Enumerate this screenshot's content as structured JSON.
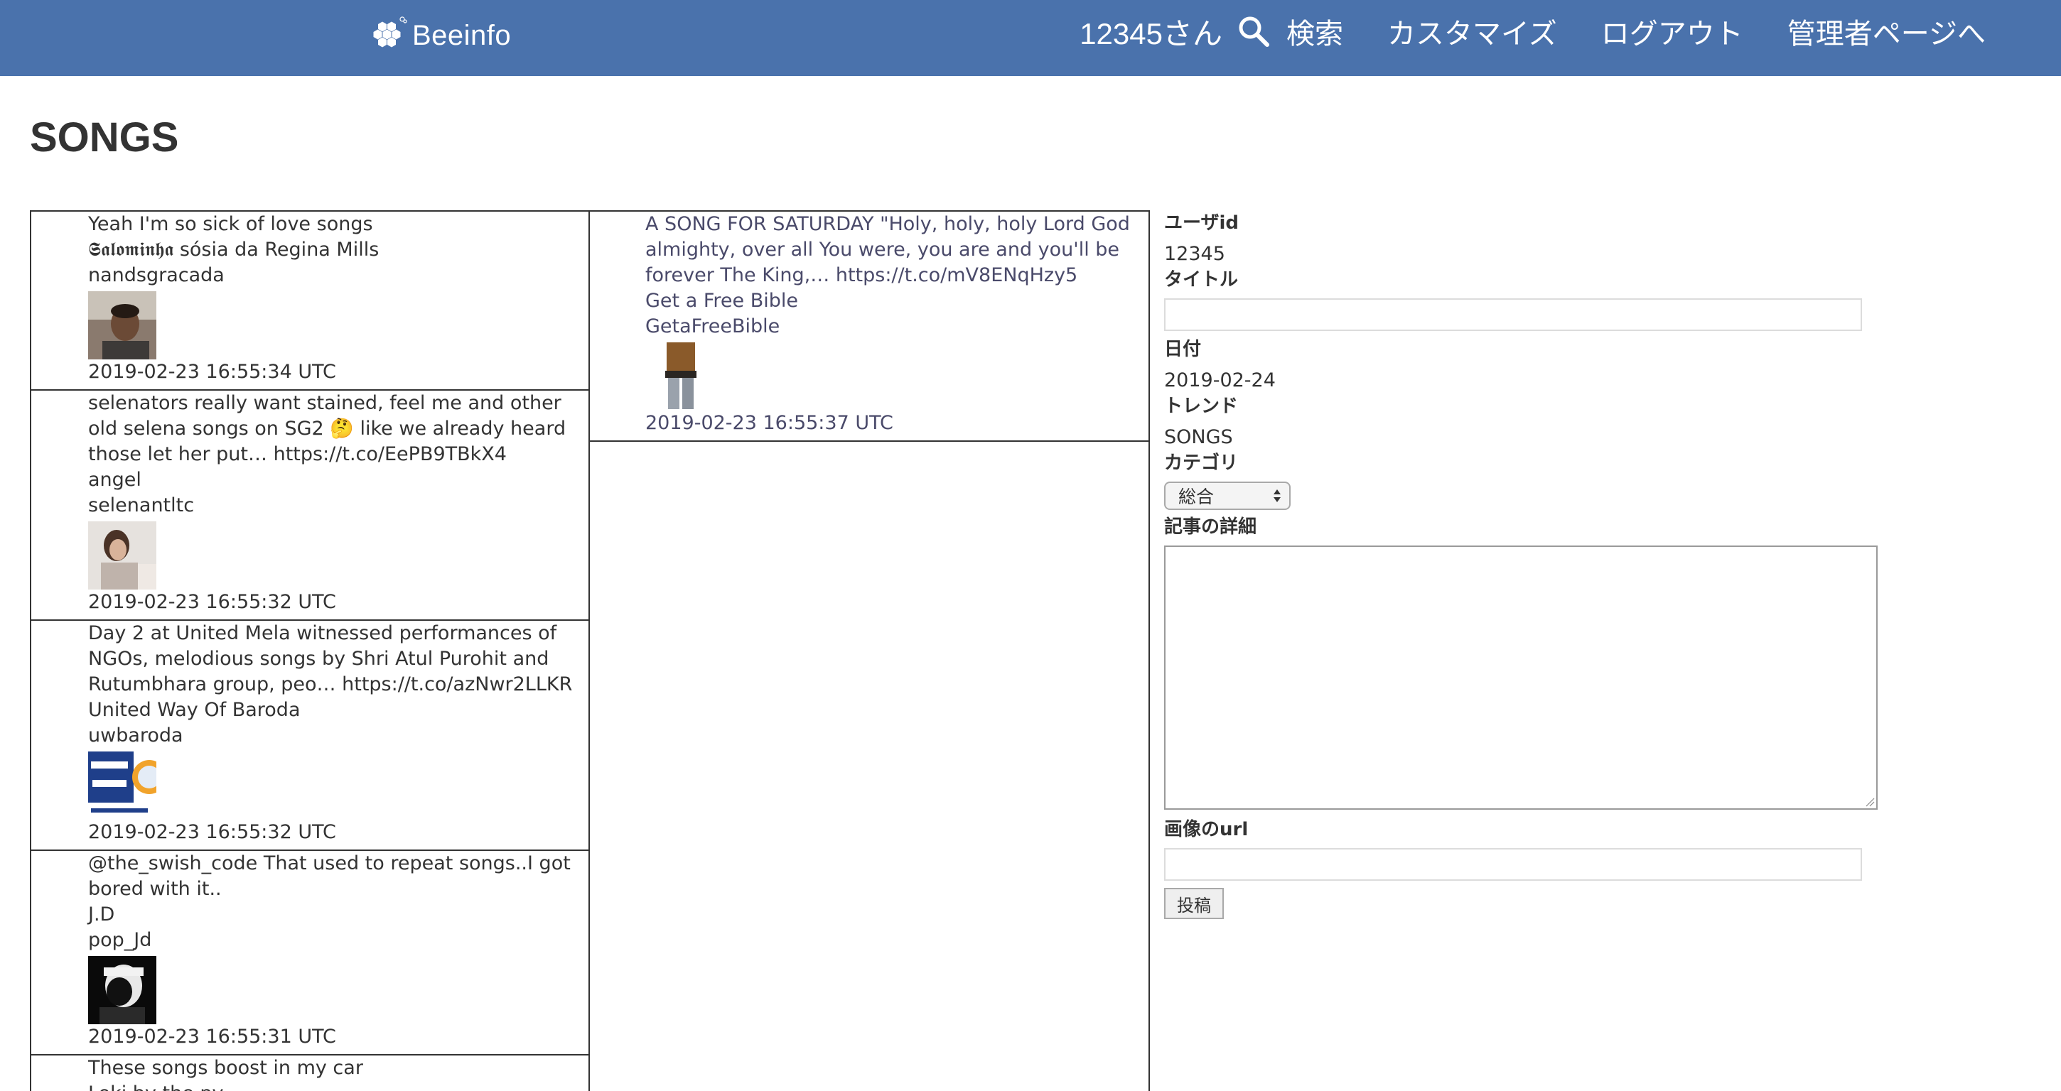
{
  "header": {
    "brand": "Beeinfo",
    "user": "12345さん",
    "search_label": "検索",
    "customize_label": "カスタマイズ",
    "logout_label": "ログアウト",
    "admin_label": "管理者ページへ",
    "color": "#4a72ac"
  },
  "page_title": "SONGS",
  "tweets_left": [
    {
      "text": "Yeah I'm so sick of love songs",
      "name": "𝕾𝖆𝖑𝖔𝖒𝖎𝖓𝖍𝖆 sósia da Regina Mills",
      "handle": "nandsgracada",
      "date": "2019-02-23 16:55:34 UTC"
    },
    {
      "text": "selenators really want stained, feel me and other old selena songs on SG2 🤔  like we already heard those let her put… https://t.co/EePB9TBkX4",
      "name": "angel",
      "handle": "selenantltc",
      "date": "2019-02-23 16:55:32 UTC"
    },
    {
      "text": "Day 2 at United Mela witnessed performances of NGOs, melodious songs by Shri Atul Purohit and Rutumbhara group, peo… https://t.co/azNwr2LLKR",
      "name": "United Way Of Baroda",
      "handle": "uwbaroda",
      "date": "2019-02-23 16:55:32 UTC"
    },
    {
      "text": "@the_swish_code That used to repeat songs..I got bored with it..",
      "name": "J.D",
      "handle": "pop_Jd",
      "date": "2019-02-23 16:55:31 UTC"
    },
    {
      "text": "These songs boost in my car",
      "name": "Loki by the pv",
      "handle": "",
      "date": ""
    }
  ],
  "tweets_right": [
    {
      "text": "A SONG FOR SATURDAY \"Holy, holy, holy Lord God almighty, over all You were, you are and you'll be forever The King,… https://t.co/mV8ENqHzy5",
      "name": "Get a Free Bible",
      "handle": "GetaFreeBible",
      "date": "2019-02-23 16:55:37 UTC"
    }
  ],
  "form": {
    "user_id_label": "ユーザid",
    "user_id_value": "12345",
    "title_label": "タイトル",
    "title_value": "",
    "date_label": "日付",
    "date_value": "2019-02-24",
    "trend_label": "トレンド",
    "trend_value": "SONGS",
    "category_label": "カテゴリ",
    "category_value": "総合",
    "detail_label": "記事の詳細",
    "detail_value": "",
    "image_url_label": "画像のurl",
    "image_url_value": "",
    "submit_label": "投稿"
  }
}
